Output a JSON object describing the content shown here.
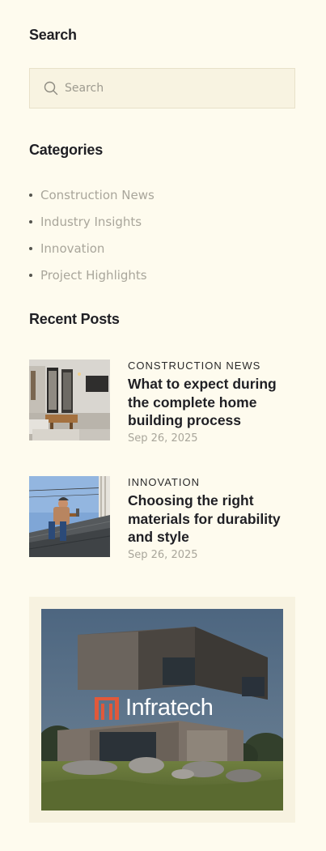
{
  "search": {
    "title": "Search",
    "placeholder": "Search"
  },
  "categories": {
    "title": "Categories",
    "items": [
      {
        "label": "Construction News"
      },
      {
        "label": "Industry Insights"
      },
      {
        "label": "Innovation"
      },
      {
        "label": "Project Highlights"
      }
    ]
  },
  "recent_posts": {
    "title": "Recent Posts",
    "items": [
      {
        "category": "CONSTRUCTION NEWS",
        "title": "What to expect during the complete home building process",
        "date": "Sep 26, 2025"
      },
      {
        "category": "INNOVATION",
        "title": "Choosing the right materials for durability and style",
        "date": "Sep 26, 2025"
      }
    ]
  },
  "banner": {
    "brand": "Infratech"
  },
  "colors": {
    "background": "#fefbee",
    "search_bg": "#f8f3e1",
    "muted_text": "#a9a69b",
    "heading": "#1f1f24",
    "logo_accent": "#e0593b"
  },
  "icons": {
    "search": "search-icon",
    "brand": "infratech-logo-icon"
  }
}
